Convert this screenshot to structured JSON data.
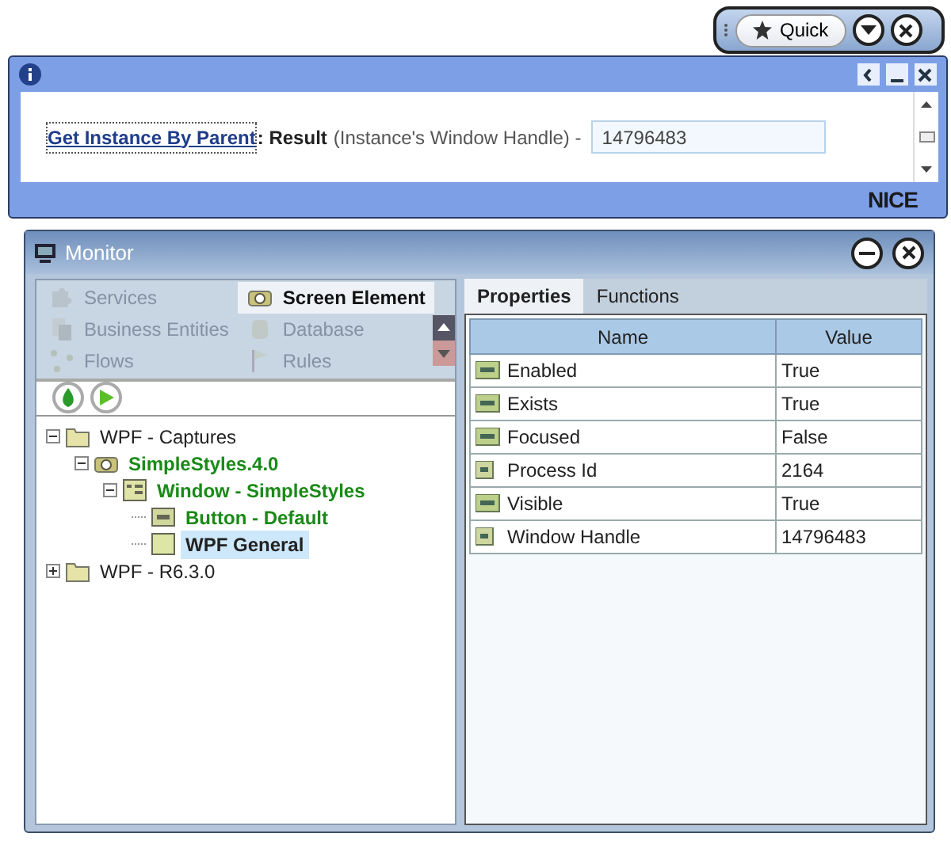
{
  "quickbar": {
    "label": "Quick"
  },
  "info_window": {
    "link": "Get Instance By Parent",
    "result_label": ": Result",
    "description": "(Instance's Window Handle) -",
    "value": "14796483",
    "brand": "NICE"
  },
  "monitor": {
    "title": "Monitor",
    "nav_items": [
      {
        "label": "Services",
        "selected": false
      },
      {
        "label": "Screen Element",
        "selected": true
      },
      {
        "label": "Business Entities",
        "selected": false
      },
      {
        "label": "Database",
        "selected": false
      },
      {
        "label": "Flows",
        "selected": false
      },
      {
        "label": "Rules",
        "selected": false
      }
    ],
    "tree": [
      {
        "label": "WPF - Captures",
        "kind": "folder",
        "expanded": true,
        "captured": false,
        "selected": false,
        "children": [
          {
            "label": "SimpleStyles.4.0",
            "kind": "camera",
            "expanded": true,
            "captured": true,
            "selected": false,
            "children": [
              {
                "label": "Window - SimpleStyles",
                "kind": "window",
                "expanded": true,
                "captured": true,
                "selected": false,
                "children": [
                  {
                    "label": "Button - Default",
                    "kind": "okbutton",
                    "captured": true,
                    "selected": false
                  },
                  {
                    "label": "WPF General",
                    "kind": "plain",
                    "captured": false,
                    "selected": true
                  }
                ]
              }
            ]
          }
        ]
      },
      {
        "label": "WPF - R6.3.0",
        "kind": "folder",
        "expanded": false,
        "captured": false,
        "selected": false
      }
    ],
    "tabs": [
      {
        "label": "Properties",
        "selected": true
      },
      {
        "label": "Functions",
        "selected": false
      }
    ],
    "table": {
      "columns": [
        "Name",
        "Value"
      ],
      "rows": [
        {
          "kind": "bool",
          "name": "Enabled",
          "value": "True"
        },
        {
          "kind": "bool",
          "name": "Exists",
          "value": "True"
        },
        {
          "kind": "bool",
          "name": "Focused",
          "value": "False"
        },
        {
          "kind": "number",
          "name": "Process Id",
          "value": "2164"
        },
        {
          "kind": "bool",
          "name": "Visible",
          "value": "True"
        },
        {
          "kind": "number",
          "name": "Window Handle",
          "value": "14796483"
        }
      ]
    }
  }
}
